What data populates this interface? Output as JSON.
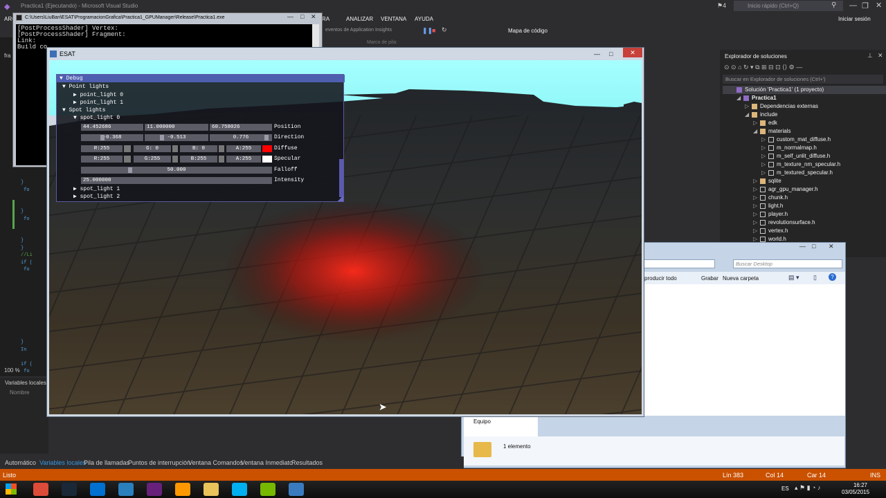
{
  "vs": {
    "title": "Practica1 (Ejecutando) - Microsoft Visual Studio",
    "notifications": "4",
    "quick_launch": "Inicio rápido (Ctrl+Q)",
    "menu": [
      "ARCHIVO",
      "RA",
      "ANALIZAR",
      "VENTANA",
      "AYUDA"
    ],
    "menu_right": "Iniciar sesión",
    "toolbar": {
      "events": "eventos de Application Insights",
      "code_map": "Mapa de código",
      "stack_frame": "Marco de pila:"
    },
    "left_labels": {
      "fra": "fra",
      "zoom": "100 %",
      "locals": "Variables locales",
      "name_col": "Nombre"
    },
    "code_fragments": [
      "}",
      "fo",
      "}",
      "fo",
      "}",
      "}",
      "//Li",
      "if (",
      "fo",
      "}",
      "In",
      "if (",
      "fo"
    ],
    "bottom_tabs": [
      "Automático",
      "Variables locales",
      "Pila de llamadas",
      "Puntos de interrupción",
      "Ventana Comandos",
      "Ventana Inmediato",
      "Resultados"
    ],
    "status": {
      "ready": "Listo",
      "line": "Lín 383",
      "col": "Col 14",
      "char": "Car 14",
      "ins": "INS"
    }
  },
  "solution_explorer": {
    "title": "Explorador de soluciones",
    "search_placeholder": "Buscar en Explorador de soluciones (Ctrl+')",
    "items": [
      {
        "label": "Solución 'Practica1' (1 proyecto)",
        "level": 0,
        "twisty": "",
        "selected": true
      },
      {
        "label": "Practica1",
        "level": 1,
        "twisty": "◢"
      },
      {
        "label": "Dependencias externas",
        "level": 2,
        "twisty": "▷"
      },
      {
        "label": "include",
        "level": 2,
        "twisty": "◢"
      },
      {
        "label": "edk",
        "level": 3,
        "twisty": "▷"
      },
      {
        "label": "materials",
        "level": 3,
        "twisty": "◢"
      },
      {
        "label": "custom_mat_diffuse.h",
        "level": 4,
        "twisty": "▷"
      },
      {
        "label": "m_normalmap.h",
        "level": 4,
        "twisty": "▷"
      },
      {
        "label": "m_self_unlit_diffuse.h",
        "level": 4,
        "twisty": "▷"
      },
      {
        "label": "m_texture_nm_specular.h",
        "level": 4,
        "twisty": "▷"
      },
      {
        "label": "m_textured_specular.h",
        "level": 4,
        "twisty": "▷"
      },
      {
        "label": "sqlite",
        "level": 3,
        "twisty": "▷"
      },
      {
        "label": "agr_gpu_manager.h",
        "level": 3,
        "twisty": "▷"
      },
      {
        "label": "chunk.h",
        "level": 3,
        "twisty": "▷"
      },
      {
        "label": "light.h",
        "level": 3,
        "twisty": "▷"
      },
      {
        "label": "player.h",
        "level": 3,
        "twisty": "▷"
      },
      {
        "label": "revolutionsurface.h",
        "level": 3,
        "twisty": "▷"
      },
      {
        "label": "vertex.h",
        "level": 3,
        "twisty": "▷"
      },
      {
        "label": "world.h",
        "level": 3,
        "twisty": "▷"
      }
    ]
  },
  "console": {
    "title": "C:\\Users\\LiuBan\\ESAT\\ProgramacionGrafica\\Practica1_GPUManager\\Release\\Practica1.exe",
    "lines": [
      "[PostProcessShader] Vertex:",
      "[PostProcessShader] Fragment:",
      "Link:",
      "",
      "",
      "Build co"
    ]
  },
  "file_explorer": {
    "search_placeholder": "Buscar Desktop",
    "toolbar": [
      "producir todo",
      "Grabar",
      "Nueva carpeta"
    ],
    "nav_item": "Equipo",
    "status": "1 elemento"
  },
  "esat": {
    "title": "ESAT",
    "imgui": {
      "window_title": "Debug",
      "point_lights": "Point lights",
      "point_light_0": "point_light 0",
      "point_light_1": "point_light 1",
      "spot_lights": "Spot lights",
      "spot_light_0": "spot_light 0",
      "position": [
        "44.452686",
        "11.000000",
        "60.758026"
      ],
      "position_label": "Position",
      "direction": [
        "-0.368",
        "-0.513",
        "0.776"
      ],
      "direction_label": "Direction",
      "diffuse": [
        "R:255",
        "G:  0",
        "B:  0",
        "A:255"
      ],
      "diffuse_label": "Diffuse",
      "diffuse_color": "#ff0000",
      "specular": [
        "R:255",
        "G:255",
        "B:255",
        "A:255"
      ],
      "specular_label": "Specular",
      "specular_color": "#ffffff",
      "falloff": "50.000",
      "falloff_label": "Falloff",
      "intensity": "25.000000",
      "intensity_label": "Intensity",
      "spot_light_1": "spot_light 1",
      "spot_light_2": "spot_light 2"
    }
  },
  "taskbar": {
    "apps": [
      "chrome-icon",
      "steam-icon",
      "uplay-icon",
      "unity-icon",
      "visual-studio-icon",
      "sublime-icon",
      "file-explorer-icon",
      "skype-icon",
      "nvidia-icon",
      "window-icon"
    ],
    "lang": "ES",
    "time": "16:27",
    "date": "03/05/2015"
  }
}
